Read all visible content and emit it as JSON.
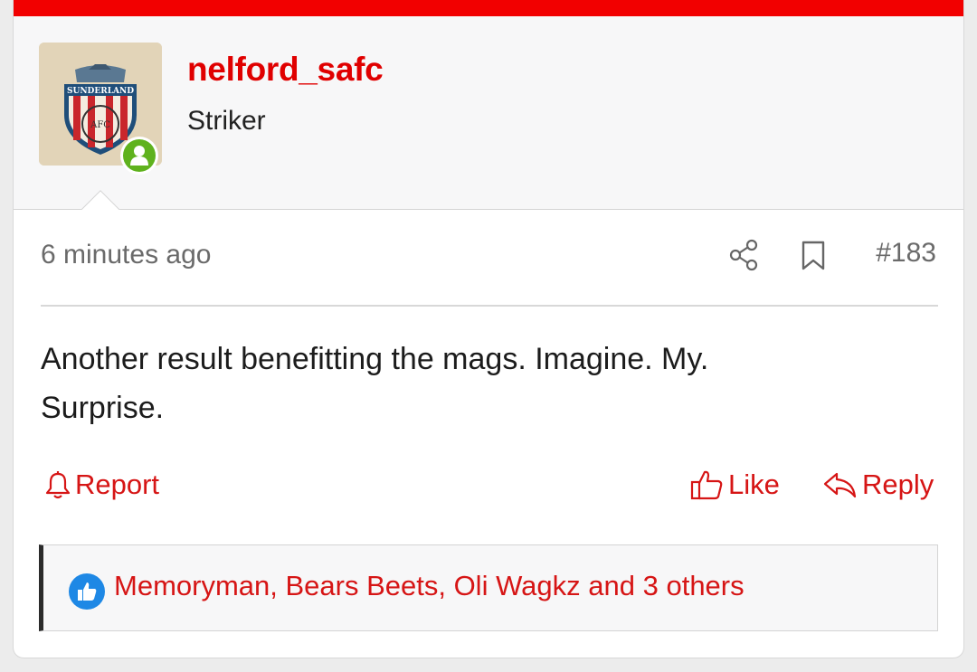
{
  "post": {
    "username": "nelford_safc",
    "user_title": "Striker",
    "timestamp": "6 minutes ago",
    "post_number": "#183",
    "message_line1": "Another result benefitting the mags. Imagine. My.",
    "message_line2": "Surprise."
  },
  "actions": {
    "report": "Report",
    "like": "Like",
    "reply": "Reply"
  },
  "reactions": {
    "text": "Memoryman, Bears Beets, Oli Wagkz and 3 others",
    "icon": "thumbs-up-icon"
  },
  "avatar": {
    "crest_text": "SUNDERLAND",
    "crest_letters": "AFC"
  },
  "colors": {
    "accent": "#e00000",
    "link": "#d61515",
    "online": "#5fb21d",
    "reaction_badge": "#1e88e5"
  }
}
